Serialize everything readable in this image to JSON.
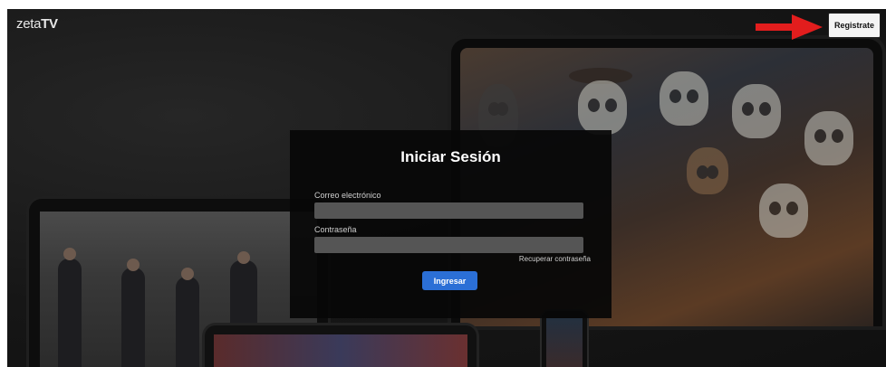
{
  "header": {
    "logo_light": "zeta",
    "logo_bold": "TV",
    "register_label": "Registrate"
  },
  "login": {
    "title": "Iniciar Sesión",
    "email_label": "Correo electrónico",
    "email_value": "",
    "password_label": "Contraseña",
    "password_value": "",
    "recover_label": "Recuperar contraseña",
    "submit_label": "Ingresar"
  },
  "colors": {
    "background": "#141414",
    "panel": "#080808",
    "input": "#555555",
    "primary_button": "#2b6fd6",
    "annotation_arrow": "#e21d1d"
  },
  "icons": {
    "annotation": "red-arrow-icon"
  }
}
